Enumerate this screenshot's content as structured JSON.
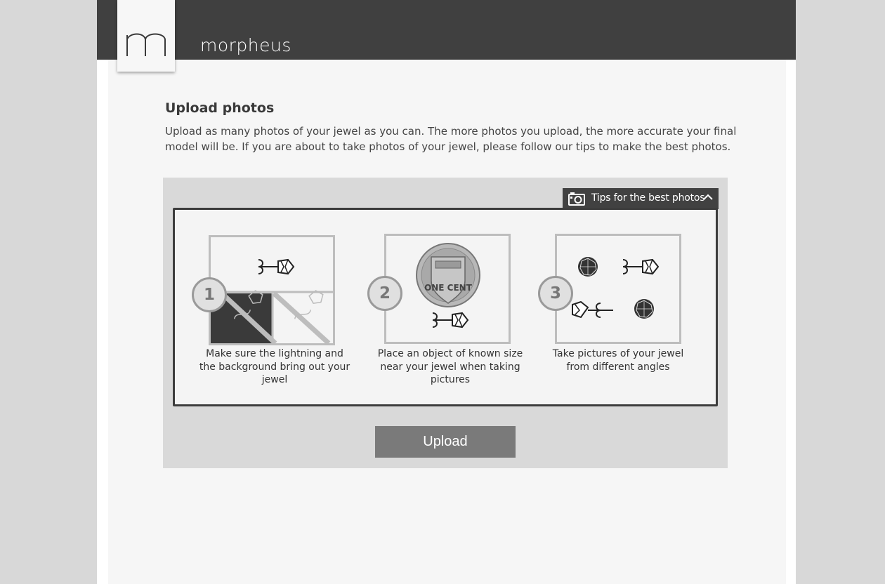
{
  "brand": {
    "logo_icon": "m-logo-icon",
    "name": "morpheus"
  },
  "page": {
    "title": "Upload photos",
    "intro": "Upload as many photos of your jewel as you can. The more photos you upload, the more accurate your final model will be. If you are about to take photos of your jewel, please follow our tips to make the best photos."
  },
  "tips": {
    "toggle_label": "Tips for the best photos",
    "toggle_icon": "camera-icon",
    "toggle_state_icon": "chevron-up-icon",
    "items": [
      {
        "number": "1",
        "caption": "Make sure the lightning and the background bring out your jewel",
        "illustration": "lighting-background-illustration"
      },
      {
        "number": "2",
        "caption": "Place an object of known size near your jewel when taking pictures",
        "illustration": "coin-size-reference-illustration",
        "coin_text": "ONE CENT"
      },
      {
        "number": "3",
        "caption": "Take pictures of your jewel from different angles",
        "illustration": "multiple-angles-illustration"
      }
    ]
  },
  "actions": {
    "upload_label": "Upload"
  },
  "colors": {
    "header": "#404040",
    "panel": "#d9d9d9",
    "button": "#7a7a7a",
    "accent_border": "#3c3c3c"
  }
}
